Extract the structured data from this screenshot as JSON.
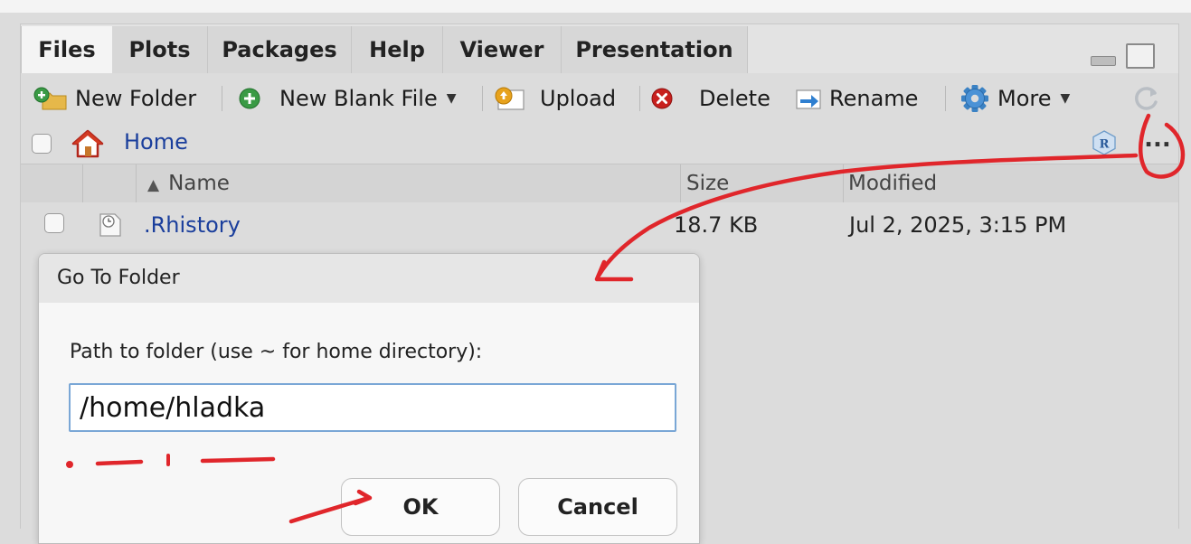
{
  "tabs": [
    "Files",
    "Plots",
    "Packages",
    "Help",
    "Viewer",
    "Presentation"
  ],
  "toolbar": {
    "new_folder": "New Folder",
    "new_blank_file": "New Blank File",
    "upload": "Upload",
    "delete": "Delete",
    "rename": "Rename",
    "more": "More"
  },
  "breadcrumb": {
    "home": "Home",
    "more_button": "..."
  },
  "columns": {
    "name": "Name",
    "size": "Size",
    "modified": "Modified"
  },
  "files": [
    {
      "name": ".Rhistory",
      "size": "18.7 KB",
      "modified": "Jul 2, 2025, 3:15 PM"
    }
  ],
  "dialog": {
    "title": "Go To Folder",
    "label": "Path to folder (use ~ for home directory):",
    "input_value": "/home/hladka",
    "ok": "OK",
    "cancel": "Cancel"
  },
  "icons": {
    "new_folder": "new-folder-icon",
    "new_blank_file": "add-file-icon",
    "upload": "upload-icon",
    "delete": "delete-icon",
    "rename": "rename-icon",
    "more": "gear-icon",
    "refresh": "refresh-icon",
    "home": "home-icon",
    "project": "r-project-icon",
    "file": "history-file-icon"
  },
  "colors": {
    "link": "#1a3e9c",
    "annotation": "#e0262b",
    "input_border": "#7aa7d6"
  }
}
